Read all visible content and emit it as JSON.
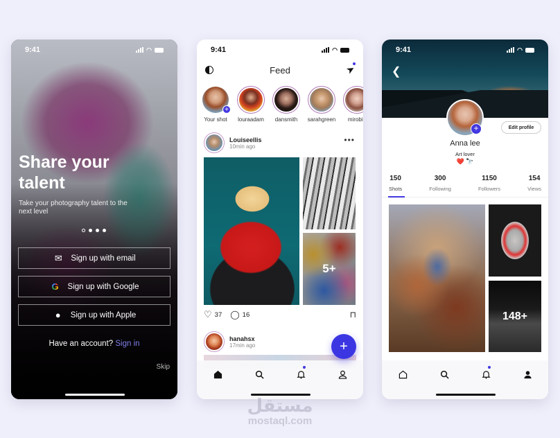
{
  "status_time": "9:41",
  "onboarding": {
    "title": "Share your talent",
    "subtitle": "Take your photography talent to the next level",
    "pager": {
      "total": 4,
      "active_index": 0
    },
    "buttons": [
      {
        "icon": "mail-icon",
        "label": "Sign up with email"
      },
      {
        "icon": "google-icon",
        "label": "Sign up with Google"
      },
      {
        "icon": "apple-icon",
        "label": "Sign up with Apple"
      }
    ],
    "have_account": "Have an account?",
    "sign_in": "Sign in",
    "skip": "Skip",
    "accent": "#7f7fe8"
  },
  "feed": {
    "title": "Feed",
    "stories": [
      {
        "name": "Your shot",
        "own": true
      },
      {
        "name": "louraadam"
      },
      {
        "name": "dansmith"
      },
      {
        "name": "sarahgreen"
      },
      {
        "name": "mirobin"
      }
    ],
    "posts": [
      {
        "user": "Louiseellis",
        "time": "10min ago",
        "more_count": "5+",
        "likes": "37",
        "comments": "16"
      },
      {
        "user": "hanahsx",
        "time": "17min ago"
      }
    ],
    "fab_label": "+",
    "accent": "#3b36e2"
  },
  "profile": {
    "name": "Anna lee",
    "bio": "Art lover",
    "emoji": "❤️ 🔭",
    "edit_label": "Edit profile",
    "stats": [
      {
        "value": "150",
        "label": "Shots"
      },
      {
        "value": "300",
        "label": "Following"
      },
      {
        "value": "1150",
        "label": "Followers"
      },
      {
        "value": "154",
        "label": "Views"
      }
    ],
    "active_tab": "Shots",
    "more_count": "148+"
  },
  "watermark": {
    "arabic": "مستقل",
    "latin": "mostaql.com"
  }
}
